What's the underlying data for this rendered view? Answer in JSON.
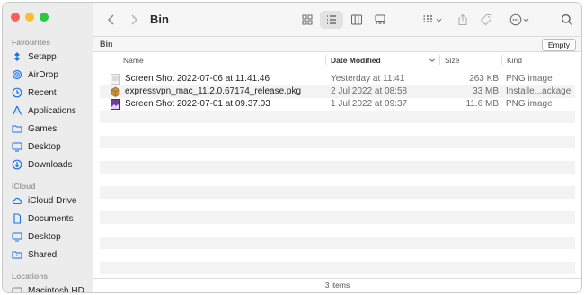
{
  "window": {
    "title": "Bin"
  },
  "colors": {
    "close": "#fe5f57",
    "minimize": "#febc2e",
    "zoom": "#28c840",
    "accent": "#1a73e8"
  },
  "sidebar": {
    "sections": [
      {
        "title": "Favourites",
        "items": [
          {
            "label": "Setapp",
            "icon": "setapp-icon"
          },
          {
            "label": "AirDrop",
            "icon": "airdrop-icon"
          },
          {
            "label": "Recent",
            "icon": "clock-icon"
          },
          {
            "label": "Applications",
            "icon": "applications-icon"
          },
          {
            "label": "Games",
            "icon": "folder-icon"
          },
          {
            "label": "Desktop",
            "icon": "desktop-icon"
          },
          {
            "label": "Downloads",
            "icon": "downloads-icon"
          }
        ]
      },
      {
        "title": "iCloud",
        "items": [
          {
            "label": "iCloud Drive",
            "icon": "cloud-icon"
          },
          {
            "label": "Documents",
            "icon": "document-icon"
          },
          {
            "label": "Desktop",
            "icon": "desktop-icon"
          },
          {
            "label": "Shared",
            "icon": "shared-folder-icon"
          }
        ]
      },
      {
        "title": "Locations",
        "items": [
          {
            "label": "Macintosh HD",
            "icon": "disk-icon"
          }
        ]
      }
    ]
  },
  "pathbar": {
    "path": "Bin",
    "empty_label": "Empty"
  },
  "columns": {
    "name": "Name",
    "date": "Date Modified",
    "size": "Size",
    "kind": "Kind"
  },
  "files": [
    {
      "name": "Screen Shot 2022-07-06 at 11.41.46",
      "date": "Yesterday at 11:41",
      "size": "263 KB",
      "kind": "PNG image",
      "icon": "image-file-icon"
    },
    {
      "name": "expressvpn_mac_11.2.0.67174_release.pkg",
      "date": "2 Jul 2022 at 08:58",
      "size": "33 MB",
      "kind": "Installe...ackage",
      "icon": "package-icon"
    },
    {
      "name": "Screen Shot 2022-07-01 at 09.37.03",
      "date": "1 Jul 2022 at 09:37",
      "size": "11.6 MB",
      "kind": "PNG image",
      "icon": "image-file-icon"
    }
  ],
  "status": {
    "count": "3 items"
  }
}
